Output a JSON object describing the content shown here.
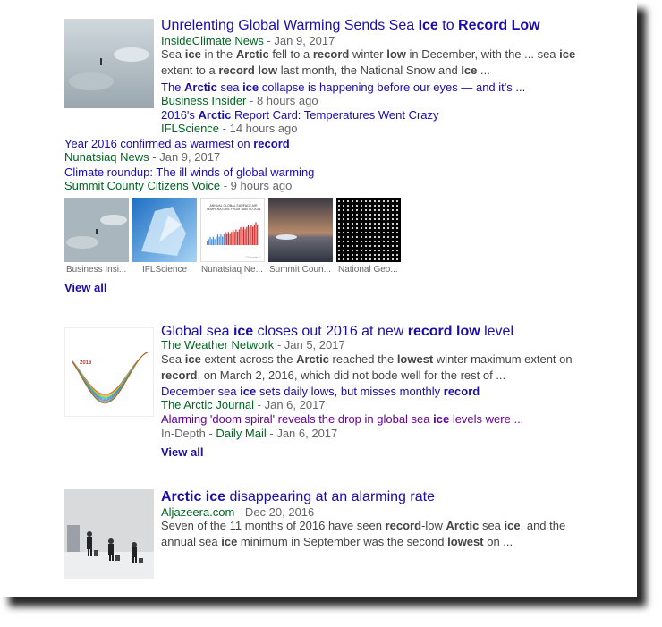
{
  "results": [
    {
      "title_parts": [
        "Unrelenting Global Warming Sends Sea ",
        "Ice",
        " to ",
        "Record Low"
      ],
      "source": "InsideClimate News",
      "date": " - Jan 9, 2017",
      "snippet_parts": [
        "Sea ",
        "ice",
        " in the ",
        "Arctic",
        " fell to a ",
        "record",
        " winter ",
        "low",
        " in December, with the ... sea ",
        "ice",
        " extent to a ",
        "record low",
        " last month, the National Snow and ",
        "Ice",
        " ..."
      ],
      "subs": [
        {
          "parts": [
            "The ",
            "Arctic",
            " sea ",
            "ice",
            " collapse is happening before our eyes — and it's ..."
          ],
          "source": "Business Insider",
          "date": " - 8 hours ago"
        },
        {
          "parts": [
            "2016's ",
            "Arctic",
            " Report Card: Temperatures Went Crazy"
          ],
          "source": "IFLScience",
          "date": " - 14 hours ago"
        },
        {
          "parts": [
            "Year 2016 confirmed as warmest on ",
            "record"
          ],
          "source": "Nunatsiaq News",
          "date": " - Jan 9, 2017"
        },
        {
          "parts": [
            "Climate roundup: The ill winds of global warming"
          ],
          "source": "Summit County Citizens Voice",
          "date": " - 9 hours ago"
        }
      ],
      "image_captions": [
        "Business Insi...",
        "IFLScience",
        "Nunatsiaq Ne...",
        "Summit Coun...",
        "National Geo..."
      ],
      "thumb_chart_title": "ANNUAL GLOBAL SURFACE AIR TEMPERATURE FROM 1880 TO 2016",
      "thumb_chart_brand": "Climate C",
      "view_all": "View all"
    },
    {
      "title_parts": [
        "Global sea ",
        "ice",
        " closes out 2016 at new ",
        "record low",
        " level"
      ],
      "source": "The Weather Network",
      "date": " - Jan 5, 2017",
      "snippet_parts": [
        "Sea ",
        "ice",
        " extent across the ",
        "Arctic",
        " reached the ",
        "lowest",
        " winter maximum extent on ",
        "record",
        ", on March 2, 2016, which did not bode well for the rest of ..."
      ],
      "subs": [
        {
          "parts": [
            "December sea ",
            "ice",
            " sets daily lows, but misses monthly ",
            "record"
          ],
          "source": "The Arctic Journal",
          "date": " - Jan 6, 2017"
        },
        {
          "parts": [
            "Alarming 'doom spiral' reveals the drop in global sea ",
            "ice",
            " levels were ..."
          ],
          "pre": "In-Depth - ",
          "source": "Daily Mail",
          "date": " - Jan 6, 2017"
        }
      ],
      "thumb_label": "2016",
      "view_all": "View all"
    },
    {
      "title_parts": [
        "Arctic ice",
        " disappearing at an alarming rate"
      ],
      "source": "Aljazeera.com",
      "date": " - Dec 20, 2016",
      "snippet_parts": [
        "Seven of the 11 months of 2016 have seen ",
        "record",
        "-low ",
        "Arctic",
        " sea ",
        "ice",
        ", and the annual sea ",
        "ice",
        " minimum in September was the second ",
        "lowest",
        " on ..."
      ]
    }
  ],
  "colors": {
    "link": "#1a0dab",
    "source": "#006621",
    "visited": "#660099",
    "snippet": "#444444"
  }
}
